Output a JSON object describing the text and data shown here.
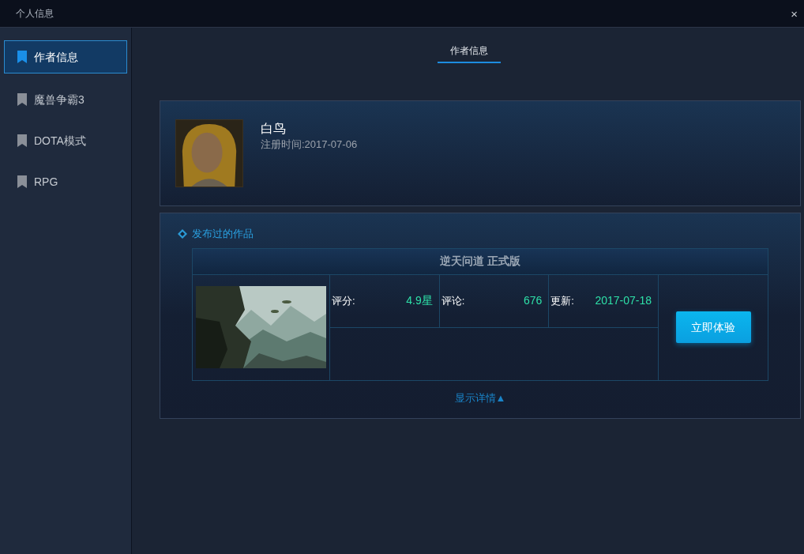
{
  "window": {
    "title": "个人信息",
    "close": "×"
  },
  "sidebar": {
    "items": [
      {
        "label": "作者信息",
        "selected": true
      },
      {
        "label": "魔兽争霸3",
        "selected": false
      },
      {
        "label": "DOTA模式",
        "selected": false
      },
      {
        "label": "RPG",
        "selected": false
      }
    ]
  },
  "tabs": [
    {
      "label": "作者信息",
      "selected": true
    }
  ],
  "profile": {
    "name": "白鸟",
    "registered": "注册时间:2017-07-06"
  },
  "works": {
    "heading": "发布过的作品",
    "items": [
      {
        "title": "逆天问道 正式版",
        "stats": [
          {
            "label": "评分:",
            "value": "4.9星"
          },
          {
            "label": "评论:",
            "value": "676"
          },
          {
            "label": "更新:",
            "value": "2017-07-18"
          }
        ],
        "button": "立即体验"
      }
    ],
    "toggle": "显示详情▲"
  }
}
